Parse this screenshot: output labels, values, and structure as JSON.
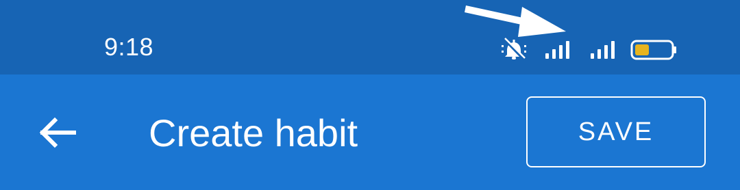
{
  "status_bar": {
    "time": "9:18",
    "icons": [
      "annotation-arrow-icon",
      "bell-off-icon",
      "signal-icon",
      "signal-icon",
      "battery-icon"
    ],
    "battery_level_percent": 40,
    "colors": {
      "background": "#1764b4",
      "battery_fill": "#e7b41f"
    }
  },
  "app_bar": {
    "back_icon": "arrow-left-icon",
    "title": "Create habit",
    "save_label": "SAVE",
    "colors": {
      "background": "#1b76d2",
      "foreground": "#ffffff"
    }
  }
}
